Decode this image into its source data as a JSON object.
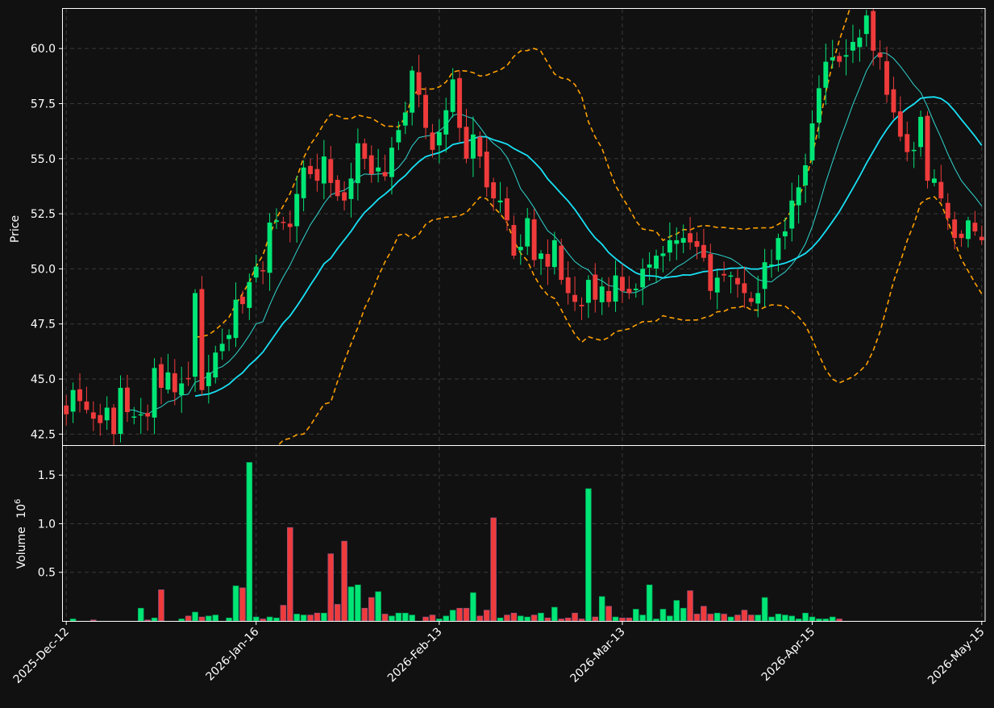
{
  "chart_data": [
    {
      "type": "candlestick",
      "panel": "price",
      "ylabel": "Price",
      "ylim": [
        42.0,
        61.8
      ],
      "yticks": [
        "42.5",
        "45.0",
        "47.5",
        "50.0",
        "52.5",
        "55.0",
        "57.5",
        "60.0"
      ],
      "xticks": [
        "2025-Dec-12",
        "2026-Jan-16",
        "2026-Feb-13",
        "2026-Mar-13",
        "2026-Apr-15",
        "2026-May-15"
      ],
      "grid": true,
      "colors": {
        "up": "#00e676",
        "down": "#ef3b3b",
        "ma_fast": "#2fd6cf",
        "ma_slow": "#18e1f5",
        "bands": "#ffa000"
      },
      "close": [
        43.4,
        44.5,
        44.0,
        43.6,
        43.2,
        43.0,
        43.7,
        42.5,
        44.6,
        43.5,
        43.3,
        43.4,
        43.3,
        45.5,
        44.6,
        45.3,
        44.4,
        44.8,
        45.0,
        48.9,
        44.5,
        45.3,
        46.2,
        46.6,
        47.0,
        48.6,
        48.4,
        49.4,
        50.1,
        49.9,
        52.1,
        52.2,
        52.1,
        51.9,
        53.4,
        54.6,
        54.3,
        54.0,
        55.1,
        53.9,
        53.3,
        53.1,
        54.1,
        55.7,
        55.0,
        54.3,
        54.6,
        54.2,
        55.5,
        56.3,
        57.1,
        59.0,
        57.9,
        56.4,
        55.4,
        56.2,
        57.2,
        58.6,
        56.4,
        55.0,
        56.1,
        55.1,
        53.7,
        53.2,
        53.1,
        52.2,
        50.6,
        51.0,
        52.3,
        50.4,
        50.7,
        50.1,
        51.3,
        49.5,
        48.9,
        48.5,
        48.3,
        49.5,
        48.6,
        49.2,
        48.5,
        49.7,
        49.0,
        48.9,
        49.1,
        50.0,
        50.2,
        50.6,
        50.7,
        51.3,
        51.3,
        51.4,
        51.2,
        51.0,
        50.5,
        49.0,
        49.6,
        49.7,
        49.7,
        49.3,
        48.9,
        48.5,
        48.9,
        50.3,
        50.2,
        51.4,
        51.7,
        53.1,
        53.7,
        54.7,
        56.6,
        58.2,
        59.4,
        59.6,
        59.4,
        59.7,
        60.3,
        60.5,
        61.5,
        59.9,
        59.6,
        57.9,
        57.1,
        56.0,
        55.3,
        55.4,
        56.9,
        54.0,
        54.1,
        53.2,
        52.3,
        51.4,
        51.4,
        52.2,
        51.7,
        51.3
      ],
      "x": [
        "2025-Dec-12",
        "2026-Jan-16",
        "2026-Feb-13",
        "2026-Mar-13",
        "2026-Apr-15",
        "2026-May-15"
      ]
    },
    {
      "type": "bar",
      "panel": "volume",
      "ylabel": "Volume  10^6",
      "ylabel_text": "Volume",
      "ylabel_exp": "6",
      "ylim": [
        0,
        1.8
      ],
      "yticks": [
        "0.5",
        "1.0",
        "1.5"
      ],
      "values": [
        0,
        0.02,
        0,
        0,
        0.01,
        0,
        0,
        0,
        0,
        0,
        0,
        0.13,
        0.01,
        0.03,
        0.32,
        0,
        0,
        0.02,
        0.05,
        0.09,
        0.04,
        0.05,
        0.06,
        0,
        0.03,
        0.36,
        0.34,
        1.63,
        0.04,
        0.02,
        0.04,
        0.03,
        0.16,
        0.96,
        0.07,
        0.06,
        0.06,
        0.08,
        0.08,
        0.69,
        0.17,
        0.82,
        0.35,
        0.37,
        0.13,
        0.24,
        0.3,
        0.07,
        0.05,
        0.08,
        0.08,
        0.06,
        0,
        0.04,
        0.06,
        0.02,
        0.05,
        0.11,
        0.13,
        0.13,
        0.29,
        0.05,
        0.11,
        1.06,
        0.03,
        0.06,
        0.08,
        0.05,
        0.04,
        0.06,
        0.08,
        0.03,
        0.14,
        0.02,
        0.03,
        0.08,
        0.02,
        1.36,
        0.04,
        0.25,
        0.15,
        0.04,
        0.03,
        0.03,
        0.12,
        0.06,
        0.37,
        0.02,
        0.12,
        0.05,
        0.21,
        0.13,
        0.31,
        0.07,
        0.15,
        0.07,
        0.08,
        0.07,
        0.04,
        0.06,
        0.11,
        0.06,
        0.06,
        0.24,
        0.04,
        0.07,
        0.06,
        0.05,
        0.02,
        0.08,
        0.04,
        0.02,
        0.02,
        0.04,
        0.02
      ],
      "x": []
    }
  ]
}
